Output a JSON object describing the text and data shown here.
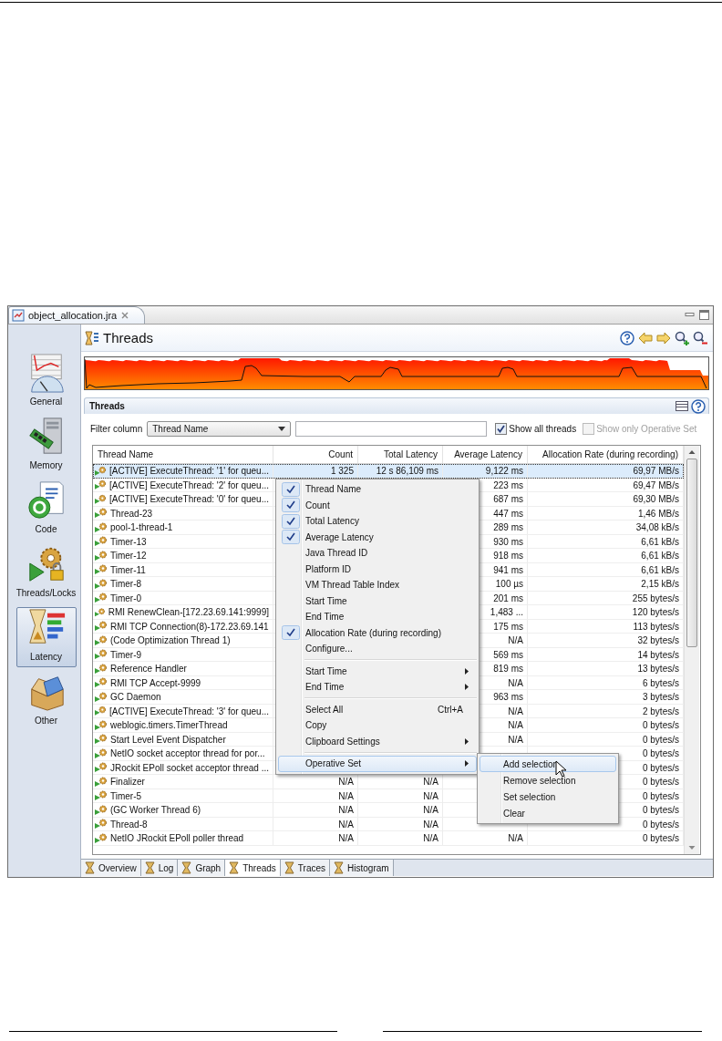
{
  "window": {
    "tab": {
      "title": "object_allocation.jra"
    }
  },
  "sidebar": {
    "items": [
      {
        "label": "General",
        "selected": false
      },
      {
        "label": "Memory",
        "selected": false
      },
      {
        "label": "Code",
        "selected": false
      },
      {
        "label": "Threads/Locks",
        "selected": false
      },
      {
        "label": "Latency",
        "selected": true
      },
      {
        "label": "Other",
        "selected": false
      }
    ]
  },
  "page": {
    "title": "Threads"
  },
  "section": {
    "title": "Threads"
  },
  "filter": {
    "label": "Filter column",
    "column": "Thread Name",
    "checkboxes": [
      {
        "label": "Show all threads",
        "checked": true,
        "disabled": false
      },
      {
        "label": "Show only Operative Set",
        "checked": false,
        "disabled": true
      }
    ]
  },
  "table": {
    "columns": [
      "Thread Name",
      "Count",
      "Total Latency",
      "Average Latency",
      "Allocation Rate (during recording)"
    ],
    "rows": [
      {
        "name": "[ACTIVE] ExecuteThread: '1' for queu...",
        "count": "1 325",
        "total_latency": "12 s 86,109 ms",
        "average_latency": "9,122 ms",
        "allocation_rate": "69,97 MB/s",
        "selected": true
      },
      {
        "name": "[ACTIVE] ExecuteThread: '2' for queu...",
        "average_latency": "223 ms",
        "allocation_rate": "69,47 MB/s",
        "selected": false
      },
      {
        "name": "[ACTIVE] ExecuteThread: '0' for queu...",
        "average_latency": "687 ms",
        "allocation_rate": "69,30 MB/s",
        "selected": false
      },
      {
        "name": "Thread-23",
        "average_latency": "447 ms",
        "allocation_rate": "1,46 MB/s",
        "selected": false
      },
      {
        "name": "pool-1-thread-1",
        "average_latency": "289 ms",
        "allocation_rate": "34,08 kB/s",
        "selected": false
      },
      {
        "name": "Timer-13",
        "average_latency": "930 ms",
        "allocation_rate": "6,61 kB/s",
        "selected": false
      },
      {
        "name": "Timer-12",
        "average_latency": "918 ms",
        "allocation_rate": "6,61 kB/s",
        "selected": false
      },
      {
        "name": "Timer-11",
        "average_latency": "941 ms",
        "allocation_rate": "6,61 kB/s",
        "selected": false
      },
      {
        "name": "Timer-8",
        "average_latency": "100 µs",
        "allocation_rate": "2,15 kB/s",
        "selected": false
      },
      {
        "name": "Timer-0",
        "average_latency": "201 ms",
        "allocation_rate": "255 bytes/s",
        "selected": false
      },
      {
        "name": "RMI RenewClean-[172.23.69.141:9999]",
        "average_latency": "1,483 ...",
        "allocation_rate": "120 bytes/s",
        "selected": false
      },
      {
        "name": "RMI TCP Connection(8)-172.23.69.141",
        "average_latency": "175 ms",
        "allocation_rate": "113 bytes/s",
        "selected": false
      },
      {
        "name": "(Code Optimization Thread 1)",
        "average_latency": "N/A",
        "allocation_rate": "32 bytes/s",
        "selected": false
      },
      {
        "name": "Timer-9",
        "average_latency": "569 ms",
        "allocation_rate": "14 bytes/s",
        "selected": false
      },
      {
        "name": "Reference Handler",
        "average_latency": "819 ms",
        "allocation_rate": "13 bytes/s",
        "selected": false
      },
      {
        "name": "RMI TCP Accept-9999",
        "average_latency": "N/A",
        "allocation_rate": "6 bytes/s",
        "selected": false
      },
      {
        "name": "GC Daemon",
        "average_latency": "963 ms",
        "allocation_rate": "3 bytes/s",
        "selected": false
      },
      {
        "name": "[ACTIVE] ExecuteThread: '3' for queu...",
        "average_latency": "N/A",
        "allocation_rate": "2 bytes/s",
        "selected": false
      },
      {
        "name": "weblogic.timers.TimerThread",
        "average_latency": "N/A",
        "allocation_rate": "0 bytes/s",
        "selected": false
      },
      {
        "name": "Start Level Event Dispatcher",
        "average_latency": "N/A",
        "allocation_rate": "0 bytes/s",
        "selected": false
      },
      {
        "name": "NetIO socket acceptor thread for por...",
        "allocation_rate": "0 bytes/s",
        "selected": false
      },
      {
        "name": "JRockit EPoll socket acceptor thread ...",
        "allocation_rate": "0 bytes/s",
        "selected": false
      },
      {
        "name": "Finalizer",
        "count": "N/A",
        "total_latency": "N/A",
        "allocation_rate": "0 bytes/s",
        "selected": false
      },
      {
        "name": "Timer-5",
        "count": "N/A",
        "total_latency": "N/A",
        "allocation_rate": "0 bytes/s",
        "selected": false
      },
      {
        "name": "(GC Worker Thread 6)",
        "count": "N/A",
        "total_latency": "N/A",
        "allocation_rate": "0 bytes/s",
        "selected": false
      },
      {
        "name": "Thread-8",
        "count": "N/A",
        "total_latency": "N/A",
        "allocation_rate": "0 bytes/s",
        "selected": false
      },
      {
        "name": "NetIO JRockit EPoll poller thread",
        "count": "N/A",
        "total_latency": "N/A",
        "average_latency": "N/A",
        "allocation_rate": "0 bytes/s",
        "selected": false
      }
    ]
  },
  "context_menu": {
    "items": [
      {
        "kind": "check",
        "label": "Thread Name",
        "checked": true,
        "selected": false
      },
      {
        "kind": "check",
        "label": "Count",
        "checked": true,
        "selected": false
      },
      {
        "kind": "check",
        "label": "Total Latency",
        "checked": true,
        "selected": false
      },
      {
        "kind": "check",
        "label": "Average Latency",
        "checked": true,
        "selected": false
      },
      {
        "kind": "check",
        "label": "Java Thread ID",
        "checked": false,
        "selected": false
      },
      {
        "kind": "check",
        "label": "Platform ID",
        "checked": false,
        "selected": false
      },
      {
        "kind": "check",
        "label": "VM Thread Table Index",
        "checked": false,
        "selected": false
      },
      {
        "kind": "check",
        "label": "Start Time",
        "checked": false,
        "selected": false
      },
      {
        "kind": "check",
        "label": "End Time",
        "checked": false,
        "selected": false
      },
      {
        "kind": "check",
        "label": "Allocation Rate (during recording)",
        "checked": true,
        "selected": false
      },
      {
        "kind": "command",
        "label": "Configure...",
        "selected": false
      },
      {
        "kind": "separator"
      },
      {
        "kind": "submenu",
        "label": "Start Time",
        "selected": false
      },
      {
        "kind": "submenu",
        "label": "End Time",
        "selected": false
      },
      {
        "kind": "separator"
      },
      {
        "kind": "command",
        "label": "Select All",
        "shortcut": "Ctrl+A",
        "selected": false
      },
      {
        "kind": "command",
        "label": "Copy",
        "selected": false
      },
      {
        "kind": "submenu",
        "label": "Clipboard Settings",
        "selected": false
      },
      {
        "kind": "separator"
      },
      {
        "kind": "submenu",
        "label": "Operative Set",
        "selected": true
      }
    ]
  },
  "submenu": {
    "items": [
      {
        "label": "Add selection",
        "selected": true
      },
      {
        "label": "Remove selection",
        "selected": false
      },
      {
        "label": "Set selection",
        "selected": false
      },
      {
        "label": "Clear",
        "selected": false
      }
    ]
  },
  "bottom_tabs": [
    {
      "label": "Overview",
      "selected": false
    },
    {
      "label": "Log",
      "selected": false
    },
    {
      "label": "Graph",
      "selected": false
    },
    {
      "label": "Threads",
      "selected": true
    },
    {
      "label": "Traces",
      "selected": false
    },
    {
      "label": "Histogram",
      "selected": false
    }
  ]
}
